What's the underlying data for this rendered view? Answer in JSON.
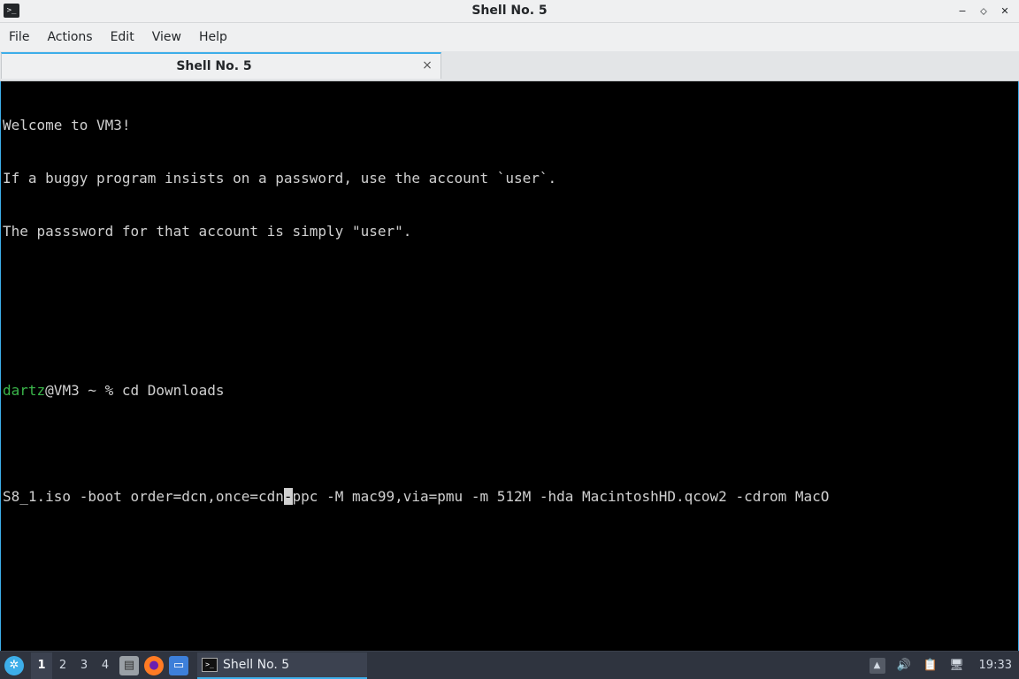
{
  "window": {
    "title": "Shell No. 5",
    "app_icon": "terminal-icon",
    "minimize": "−",
    "maximize": "⬦",
    "close": "✕"
  },
  "menu": {
    "items": [
      "File",
      "Actions",
      "Edit",
      "View",
      "Help"
    ]
  },
  "tabs": [
    {
      "label": "Shell No. 5",
      "close": "×"
    }
  ],
  "terminal": {
    "welcome": [
      "Welcome to VM3!",
      "If a buggy program insists on a password, use the account `user`.",
      "The passsword for that account is simply \"user\"."
    ],
    "prompt_user": "dartz",
    "prompt_rest": "@VM3 ~ % cd Downloads",
    "command_before_cursor": "S8_1.iso -boot order=dcn,once=cdn",
    "cursor_char": "-",
    "command_after_cursor": "ppc -M mac99,via=pmu -m 512M -hda MacintoshHD.qcow2 -cdrom MacO",
    "colors": {
      "background": "#000000",
      "text": "#d0d0d0",
      "prompt_user": "#3ab54a"
    }
  },
  "taskbar": {
    "start_icon": "start-menu-icon",
    "desktops": [
      "1",
      "2",
      "3",
      "4"
    ],
    "active_desktop": "1",
    "launchers": [
      "files-icon",
      "firefox-icon",
      "show-desktop-icon"
    ],
    "task": {
      "label": "Shell No. 5",
      "icon": "terminal-icon"
    },
    "tray": [
      "tray-up-arrow-icon",
      "volume-icon",
      "clipboard-icon",
      "network-icon"
    ],
    "clock": "19:33"
  }
}
